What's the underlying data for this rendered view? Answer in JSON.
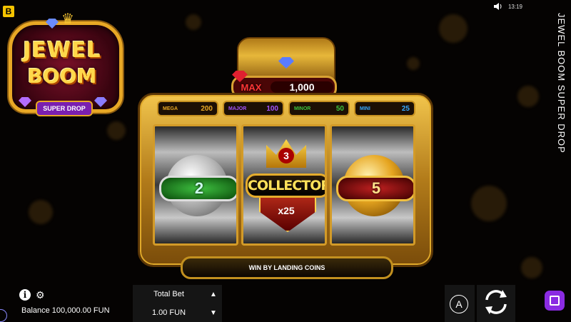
{
  "topbar": {
    "brand_icon": "B",
    "time": "13:19"
  },
  "title_vertical": "JEWEL BOOM SUPER DROP",
  "logo": {
    "line1": "JEWEL",
    "line2": "BOOM",
    "subtitle": "SUPER DROP"
  },
  "max_prize": {
    "label": "MAX",
    "value": "1,000"
  },
  "jackpots": [
    {
      "label": "MEGA",
      "value": "200",
      "color": "#e8a825"
    },
    {
      "label": "MAJOR",
      "value": "100",
      "color": "#a455ff"
    },
    {
      "label": "MINOR",
      "value": "50",
      "color": "#3fc43f"
    },
    {
      "label": "MINI",
      "value": "25",
      "color": "#38a8ff"
    }
  ],
  "reels": [
    {
      "type": "coin",
      "style": "silver",
      "value": "2"
    },
    {
      "type": "collector",
      "level": "3",
      "label": "COLLECTOR",
      "multiplier": "x25"
    },
    {
      "type": "coin",
      "style": "gold",
      "value": "5"
    }
  ],
  "banner": "WIN BY LANDING COINS",
  "footer": {
    "info_icon": "i",
    "balance": "Balance 100,000.00 FUN",
    "total_bet_label": "Total Bet",
    "total_bet_value": "1.00 FUN",
    "auto_label": "A"
  }
}
